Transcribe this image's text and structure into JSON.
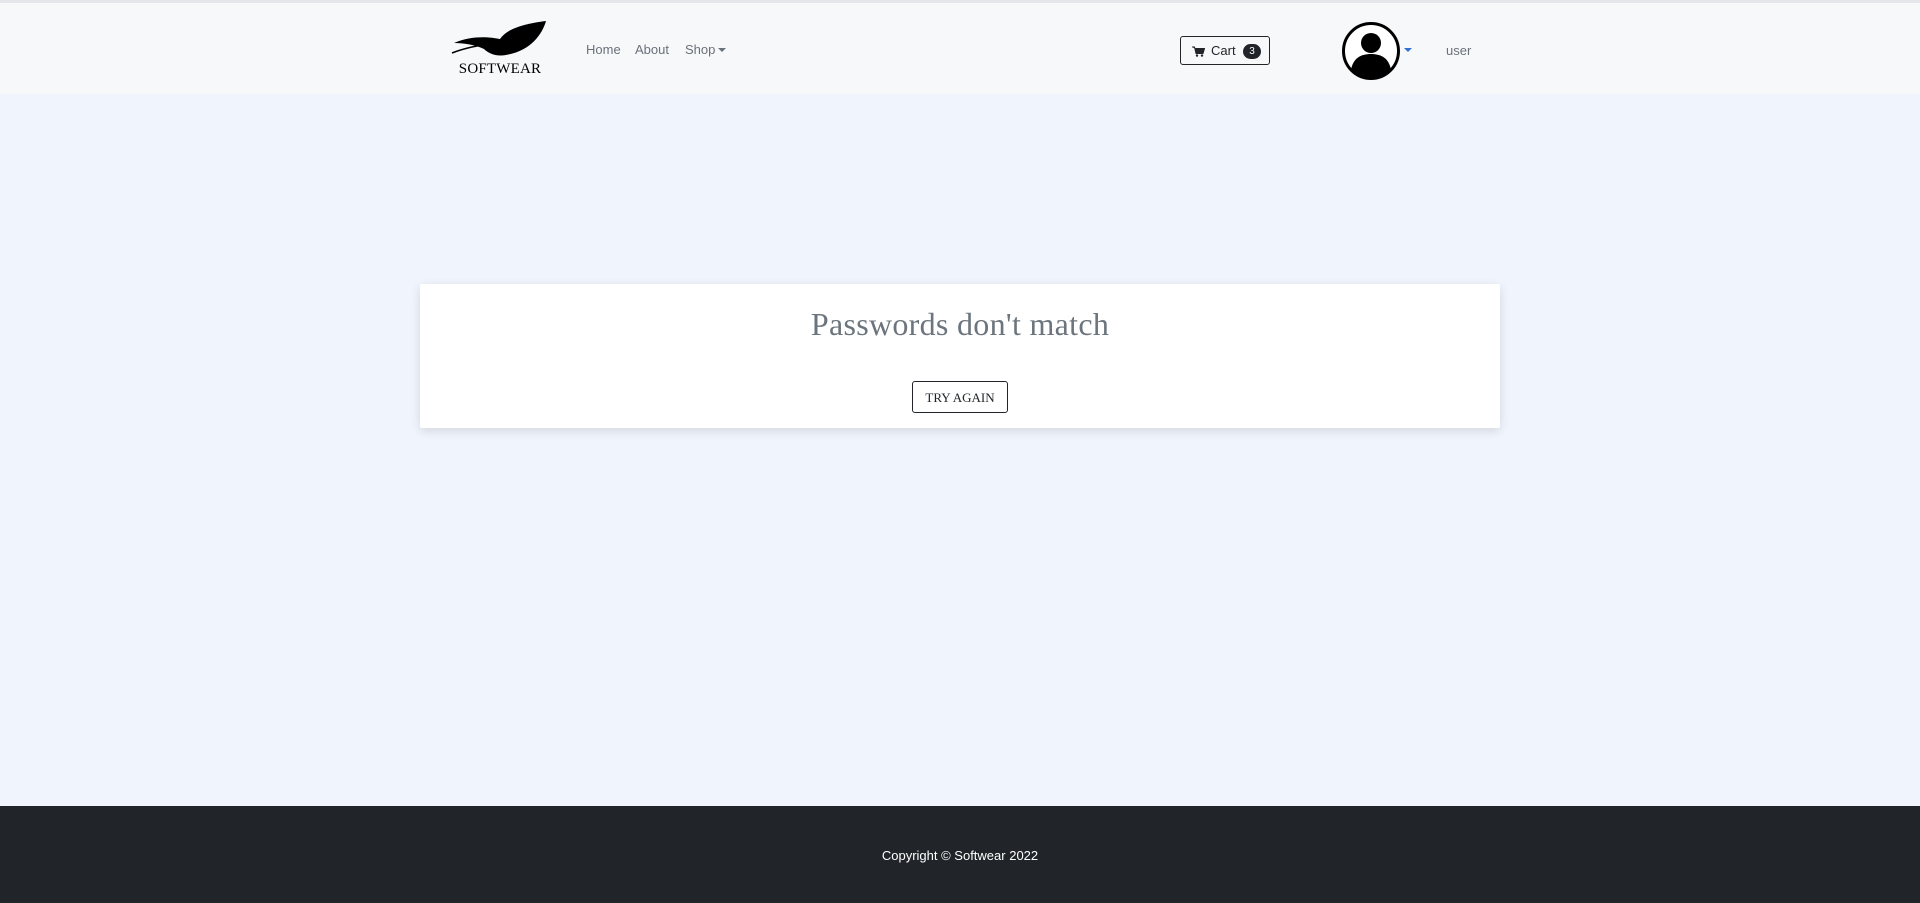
{
  "brand": {
    "name": "SOFTWEAR",
    "icon": "feather-logo"
  },
  "nav": {
    "home": "Home",
    "about": "About",
    "shop": "Shop"
  },
  "cart": {
    "label": "Cart",
    "count": "3",
    "icon": "cart-icon"
  },
  "user": {
    "avatar_icon": "user-avatar-icon",
    "name": "user"
  },
  "message": {
    "title": "Passwords don't match",
    "button": "TRY AGAIN"
  },
  "footer": {
    "text": "Copyright © Softwear 2022"
  },
  "colors": {
    "page_background": "#f0f4fc",
    "navbar_background": "#f7f8fa",
    "footer_background": "#212429",
    "accent": "#2f6fd6"
  }
}
